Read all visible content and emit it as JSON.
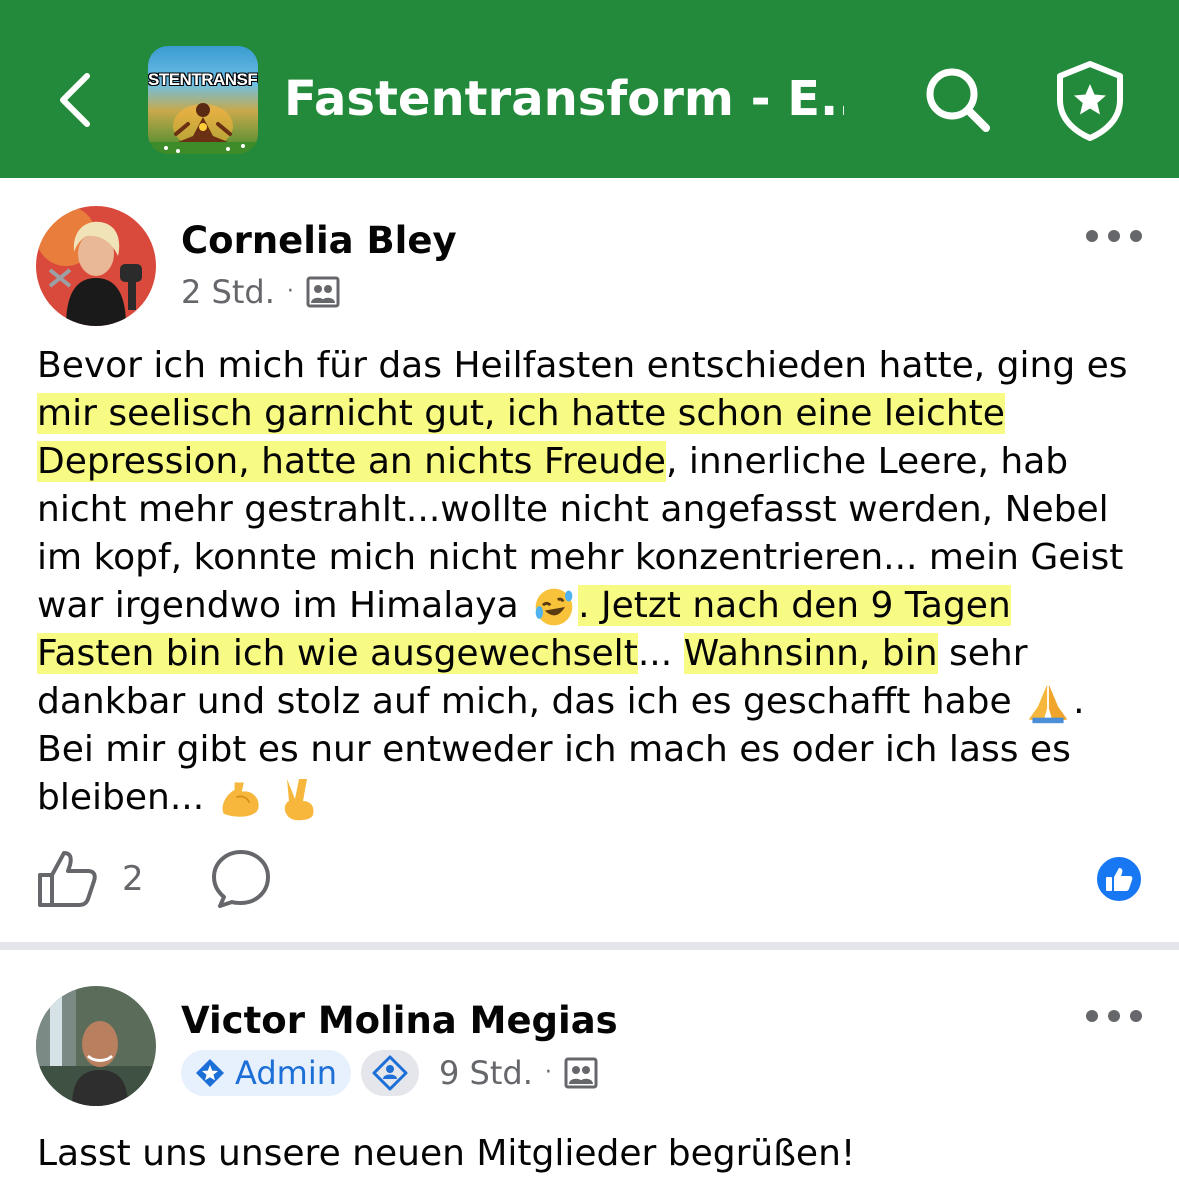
{
  "header": {
    "group_name": "Fastentransform  - E...",
    "group_avatar_text": "STENTRANSFOR",
    "background_color": "#228a3a"
  },
  "posts": [
    {
      "author": "Cornelia Bley",
      "time": "2 Std.",
      "meta_separator": "·",
      "text_lines": [
        [
          "Bevor ich mich für das Heilfasten entschieden hatte, ging es"
        ],
        [
          "mir seelisch garnicht gut, ich hatte schon eine leichte"
        ],
        [
          "Depression, hatte an nichts Freude",
          ", innerliche Leere, hab"
        ],
        [
          "nicht mehr gestrahlt...wollte nicht angefasst werden, Nebel"
        ],
        [
          "im kopf, konnte mich nicht mehr konzentrieren... mein Geist"
        ],
        [
          "war irgendwo im Himalaya ",
          ". Jetzt nach den 9 Tagen"
        ],
        [
          "Fasten bin ich wie ausgewechselt",
          "... ",
          "Wahnsinn, bin",
          " sehr"
        ],
        [
          "dankbar und stolz auf mich, das ich es geschafft habe ",
          "."
        ],
        [
          "Bei mir gibt es nur entweder ich mach es oder ich lass es"
        ],
        [
          "bleiben... ",
          " "
        ]
      ],
      "emojis": [
        "rolling-laughing",
        "folded-hands",
        "flexed-biceps",
        "victory-hand"
      ],
      "like_count": "2",
      "reaction_type": "like"
    },
    {
      "author": "Victor Molina Megias",
      "admin_label": "Admin",
      "time": "9 Std.",
      "meta_separator": "·",
      "text_first_line": "Lasst uns unsere neuen Mitglieder begrüßen!"
    }
  ]
}
